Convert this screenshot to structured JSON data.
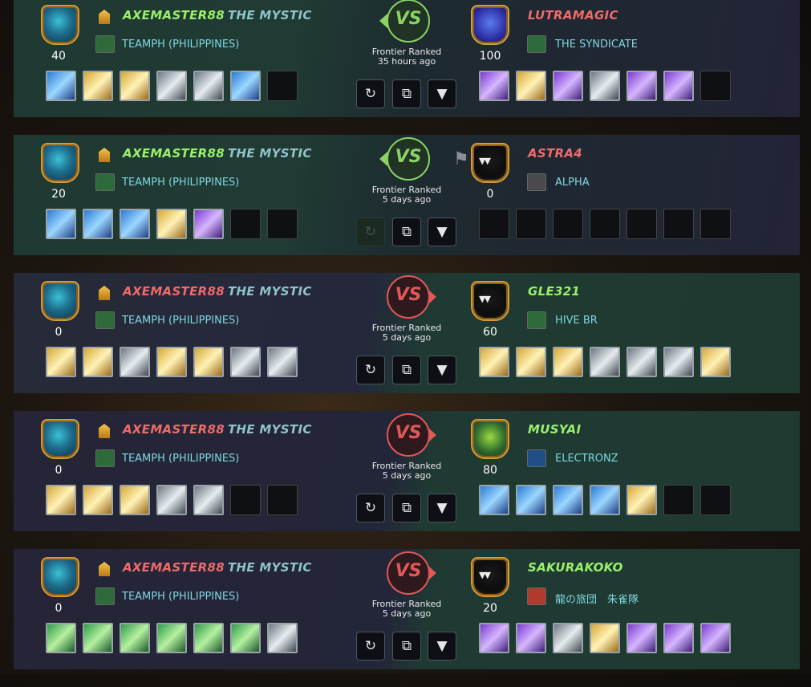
{
  "matches": [
    {
      "result": "win",
      "left": {
        "name": "AXEMASTER88",
        "title": "THE MYSTIC",
        "guild": "TEAMPH (PHILIPPINES)",
        "score": "40",
        "cards": [
          "blue",
          "gold",
          "gold",
          "gray",
          "gray",
          "blue",
          "empty"
        ]
      },
      "right": {
        "name": "LUTRAMAGIC",
        "guild": "THE SYNDICATE",
        "score": "100",
        "name_color": "red",
        "cards": [
          "purple",
          "gold",
          "purple",
          "gray",
          "purple",
          "purple",
          "empty"
        ]
      },
      "mode": "Frontier Ranked",
      "time": "35 hours ago"
    },
    {
      "result": "win",
      "left": {
        "name": "AXEMASTER88",
        "title": "THE MYSTIC",
        "guild": "TEAMPH (PHILIPPINES)",
        "score": "20",
        "cards": [
          "blue",
          "blue",
          "blue",
          "gold",
          "purple",
          "empty",
          "empty"
        ]
      },
      "right": {
        "name": "ASTRA4",
        "guild": "ALPHA",
        "score": "0",
        "name_color": "red",
        "cards": [
          "empty",
          "empty",
          "empty",
          "empty",
          "empty",
          "empty",
          "empty"
        ]
      },
      "mode": "Frontier Ranked",
      "time": "5 days ago"
    },
    {
      "result": "lose",
      "left": {
        "name": "AXEMASTER88",
        "title": "THE MYSTIC",
        "guild": "TEAMPH (PHILIPPINES)",
        "score": "0",
        "cards": [
          "gold",
          "gold",
          "gray",
          "gold",
          "gold",
          "gray",
          "gray"
        ]
      },
      "right": {
        "name": "GLE321",
        "guild": "HIVE BR",
        "score": "60",
        "name_color": "green",
        "cards": [
          "gold",
          "gold",
          "gold",
          "gray",
          "gray",
          "gray",
          "gold"
        ]
      },
      "mode": "Frontier Ranked",
      "time": "5 days ago"
    },
    {
      "result": "lose",
      "left": {
        "name": "AXEMASTER88",
        "title": "THE MYSTIC",
        "guild": "TEAMPH (PHILIPPINES)",
        "score": "0",
        "cards": [
          "gold",
          "gold",
          "gold",
          "gray",
          "gray",
          "empty",
          "empty"
        ]
      },
      "right": {
        "name": "MUSYAI",
        "guild": "ELECTRONZ",
        "score": "80",
        "name_color": "green",
        "cards": [
          "blue",
          "blue",
          "blue",
          "blue",
          "gold",
          "empty",
          "empty"
        ]
      },
      "mode": "Frontier Ranked",
      "time": "5 days ago"
    },
    {
      "result": "lose",
      "left": {
        "name": "AXEMASTER88",
        "title": "THE MYSTIC",
        "guild": "TEAMPH (PHILIPPINES)",
        "score": "0",
        "cards": [
          "green",
          "green",
          "green",
          "green",
          "green",
          "green",
          "gray"
        ]
      },
      "right": {
        "name": "SAKURAKOKO",
        "guild": "龍の旅団　朱雀隊",
        "score": "20",
        "name_color": "green",
        "cards": [
          "purple",
          "purple",
          "gray",
          "gold",
          "purple",
          "purple",
          "purple"
        ]
      },
      "mode": "Frontier Ranked",
      "time": "5 days ago"
    }
  ],
  "vs_label": "VS",
  "icons": {
    "replay": "replay-icon",
    "copy": "copy-icon",
    "expand": "chevron-down-icon",
    "surrender": "white-flag-icon"
  },
  "colors": {
    "win_green": "#8bd264",
    "lose_red": "#e05858",
    "guild_text": "#7fd6e0"
  }
}
